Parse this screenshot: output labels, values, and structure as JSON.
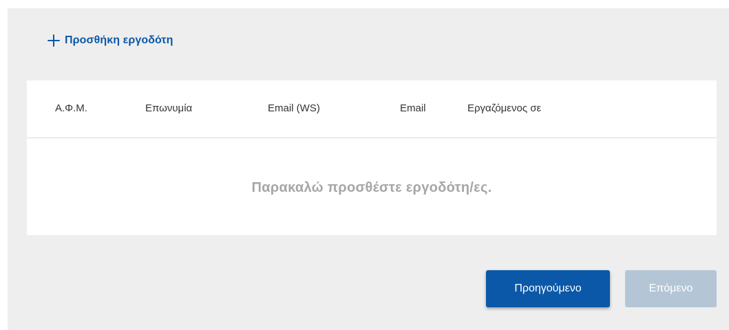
{
  "add_employer": {
    "label": "Προσθήκη εργοδότη",
    "icon": "plus-icon"
  },
  "table": {
    "columns": [
      "Α.Φ.Μ.",
      "Επωνυμία",
      "Email (WS)",
      "Email",
      "Εργαζόμενος σε"
    ],
    "rows": [],
    "empty_message": "Παρακαλώ προσθέστε εργοδότη/ες."
  },
  "buttons": {
    "previous_label": "Προηγούμενο",
    "next_label": "Επόμενο"
  },
  "colors": {
    "accent": "#0b58a8",
    "panel_background": "#eeeeee",
    "disabled_button": "#b4c6d6",
    "empty_message": "#a6a6a6"
  }
}
